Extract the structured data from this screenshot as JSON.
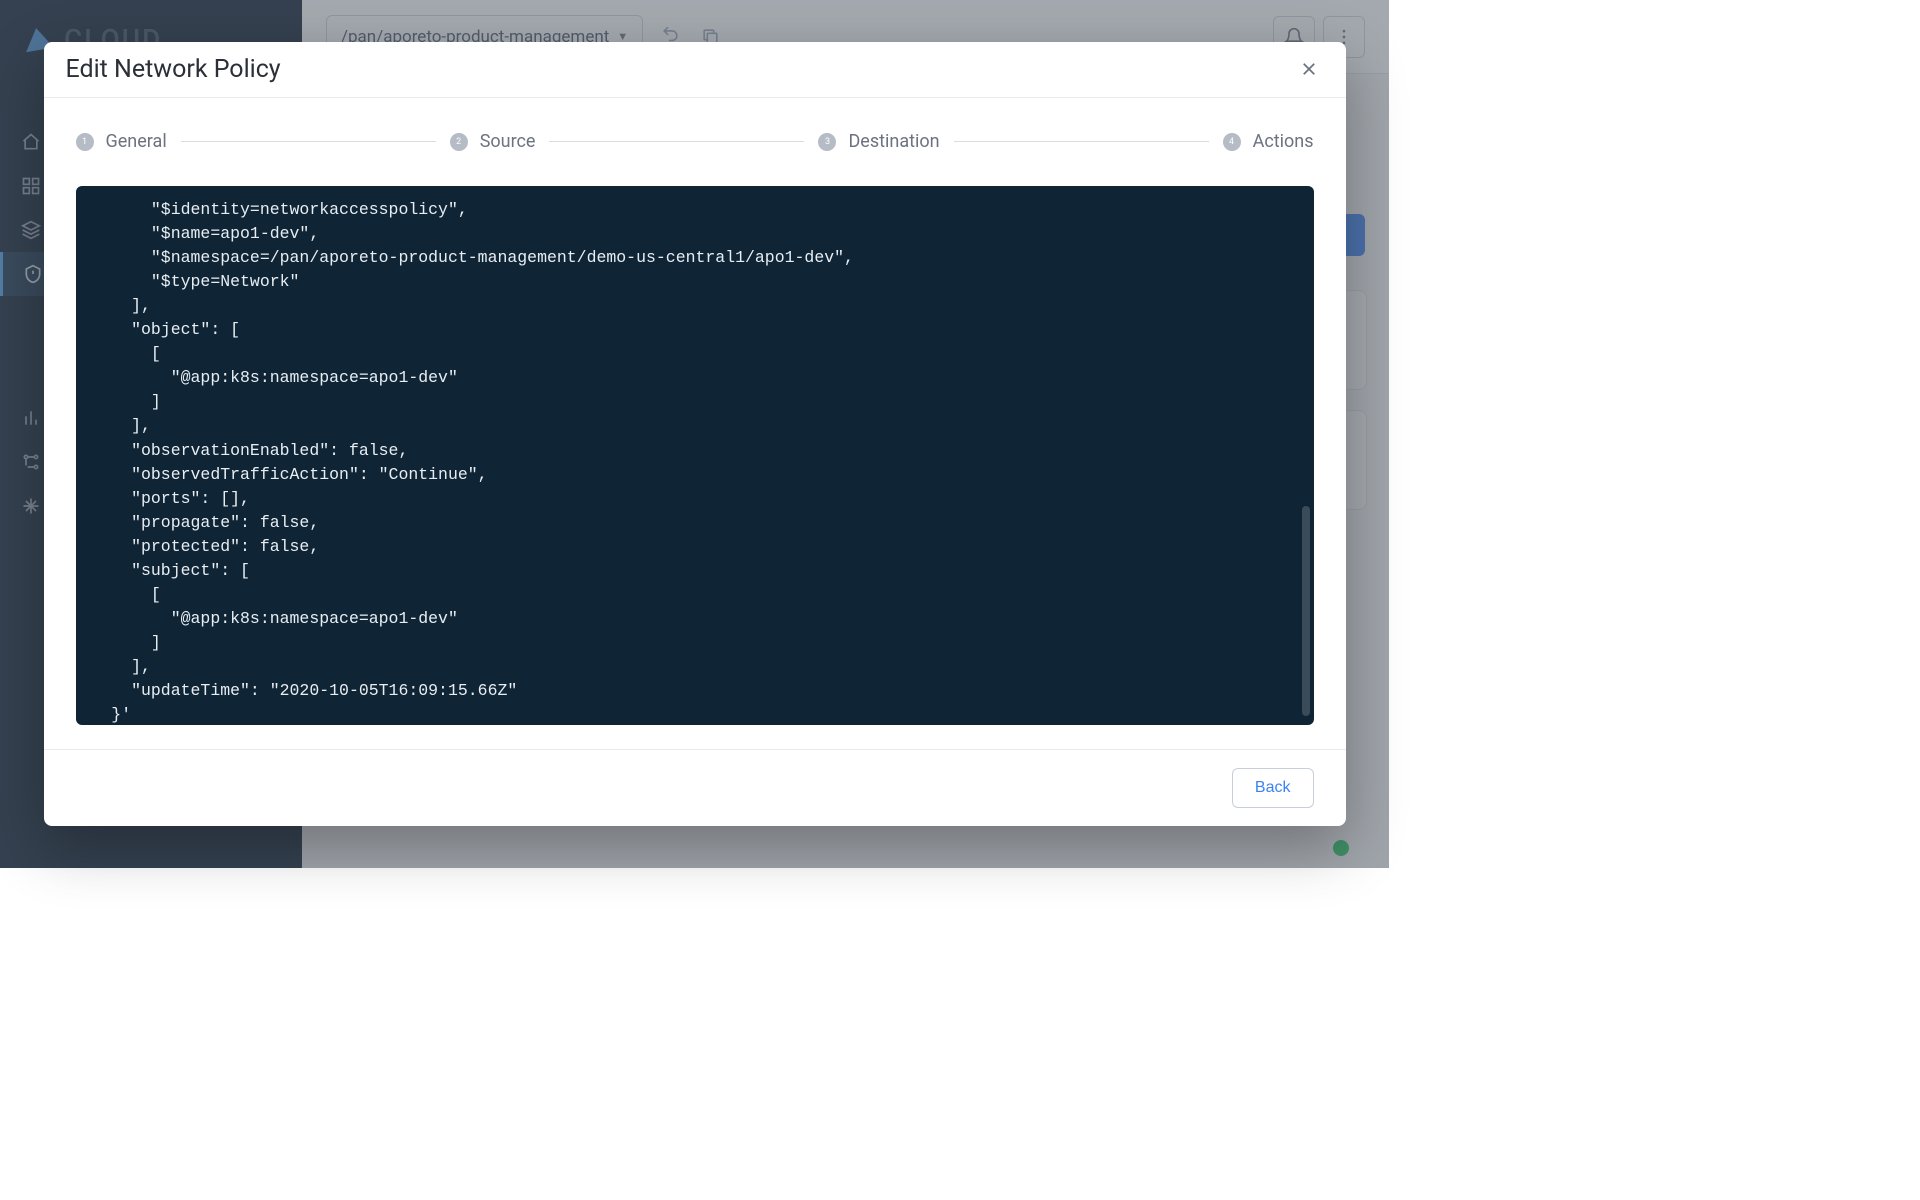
{
  "topbar": {
    "breadcrumb": "/pan/aporeto-product-management"
  },
  "sidebar": {
    "logo_text": "CLOUD"
  },
  "modal": {
    "title": "Edit Network Policy",
    "steps": [
      {
        "num": "1",
        "label": "General"
      },
      {
        "num": "2",
        "label": "Source"
      },
      {
        "num": "3",
        "label": "Destination"
      },
      {
        "num": "4",
        "label": "Actions"
      }
    ],
    "code": "      \"$identity=networkaccesspolicy\",\n      \"$name=apo1-dev\",\n      \"$namespace=/pan/aporeto-product-management/demo-us-central1/apo1-dev\",\n      \"$type=Network\"\n    ],\n    \"object\": [\n      [\n        \"@app:k8s:namespace=apo1-dev\"\n      ]\n    ],\n    \"observationEnabled\": false,\n    \"observedTrafficAction\": \"Continue\",\n    \"ports\": [],\n    \"propagate\": false,\n    \"protected\": false,\n    \"subject\": [\n      [\n        \"@app:k8s:namespace=apo1-dev\"\n      ]\n    ],\n    \"updateTime\": \"2020-10-05T16:09:15.66Z\"\n  }'",
    "back_label": "Back"
  }
}
